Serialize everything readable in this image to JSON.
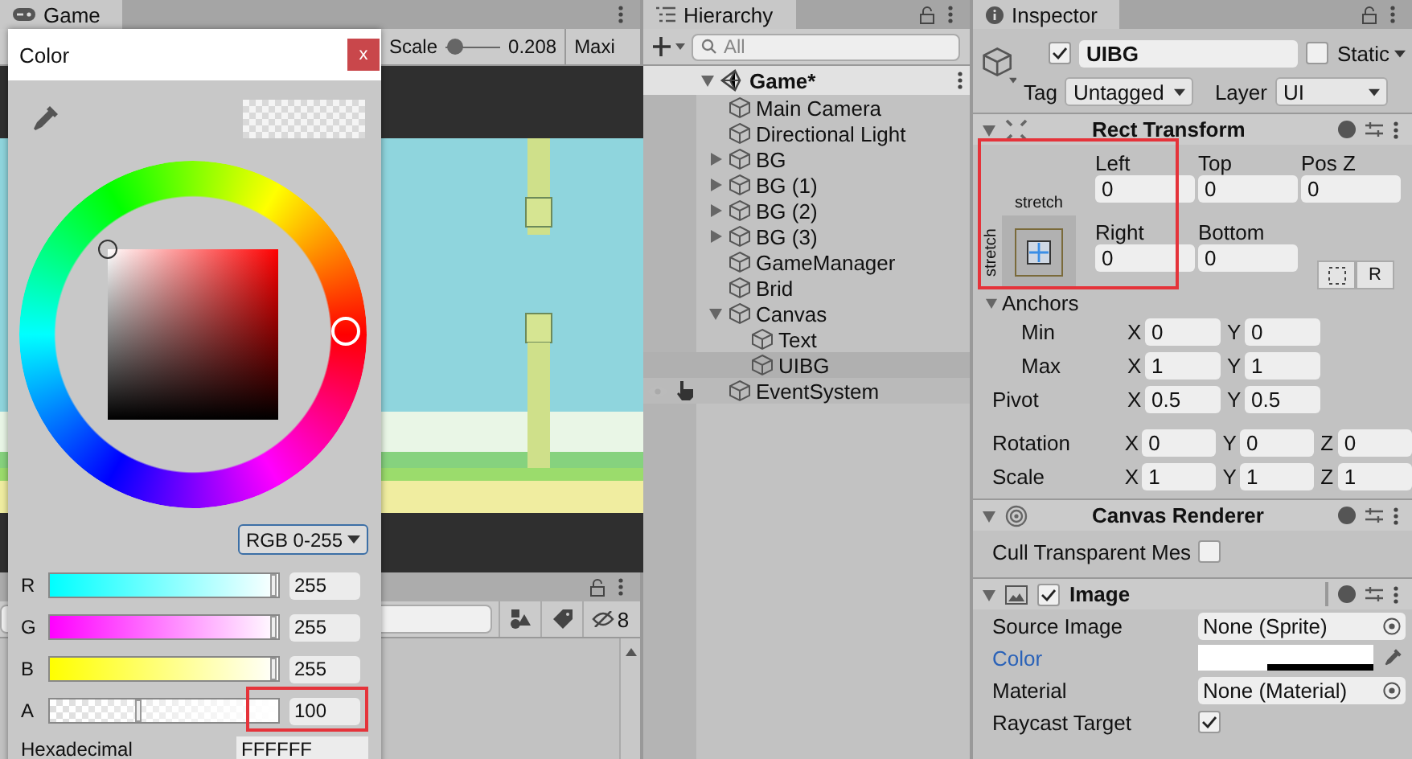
{
  "game": {
    "tab": "Game",
    "scale": {
      "label": "Scale",
      "level": 0.02,
      "value": "0.208"
    },
    "aspect": "Maxi"
  },
  "project": {
    "hidden_count": "8"
  },
  "color_window": {
    "title": "Color",
    "close": "x",
    "mode": "RGB 0-255",
    "channels": [
      {
        "label": "R",
        "kind": "red",
        "level": 1,
        "value": "255"
      },
      {
        "label": "G",
        "kind": "green",
        "level": 1,
        "value": "255"
      },
      {
        "label": "B",
        "kind": "blue",
        "level": 1,
        "value": "255"
      },
      {
        "label": "A",
        "kind": "alpha",
        "level": 0.39,
        "value": "100"
      }
    ],
    "hex_label": "Hexadecimal",
    "hex": "FFFFFF"
  },
  "hierarchy": {
    "tab": "Hierarchy",
    "search_placeholder": "All",
    "scene": {
      "name": "Game*",
      "expanded": true,
      "children": [
        {
          "name": "Main Camera",
          "selected": false,
          "hovered": false
        },
        {
          "name": "Directional Light",
          "selected": false,
          "hovered": false
        },
        {
          "name": "BG",
          "expanded": false,
          "selected": false,
          "hovered": false
        },
        {
          "name": "BG (1)",
          "expanded": false,
          "selected": false,
          "hovered": false
        },
        {
          "name": "BG (2)",
          "expanded": false,
          "selected": false,
          "hovered": false
        },
        {
          "name": "BG (3)",
          "expanded": false,
          "selected": false,
          "hovered": false
        },
        {
          "name": "GameManager",
          "selected": false,
          "hovered": false
        },
        {
          "name": "Brid",
          "selected": false,
          "hovered": false
        },
        {
          "name": "Canvas",
          "expanded": true,
          "selected": false,
          "hovered": false,
          "children": [
            {
              "name": "Text",
              "selected": false,
              "hovered": false
            },
            {
              "name": "UIBG",
              "selected": true,
              "hovered": false
            }
          ]
        },
        {
          "name": "EventSystem",
          "selected": false,
          "hovered": true
        }
      ]
    }
  },
  "inspector": {
    "tab": "Inspector",
    "object": {
      "active": true,
      "name": "UIBG",
      "static": false,
      "static_label": "Static",
      "tag_label": "Tag",
      "tag": "Untagged",
      "layer_label": "Layer",
      "layer": "UI"
    },
    "rect_transform": {
      "title": "Rect Transform",
      "expanded": true,
      "preset_h": "stretch",
      "preset_v": "stretch",
      "fields": [
        {
          "label": "Left",
          "value": "0"
        },
        {
          "label": "Top",
          "value": "0"
        },
        {
          "label": "Pos Z",
          "value": "0"
        },
        {
          "label": "Right",
          "value": "0"
        },
        {
          "label": "Bottom",
          "value": "0"
        }
      ],
      "raw_button": "R",
      "anchors": {
        "label": "Anchors",
        "expanded": true,
        "rows": [
          {
            "label": "Min",
            "axes": [
              {
                "axis": "X",
                "value": "0"
              },
              {
                "axis": "Y",
                "value": "0"
              }
            ]
          },
          {
            "label": "Max",
            "axes": [
              {
                "axis": "X",
                "value": "1"
              },
              {
                "axis": "Y",
                "value": "1"
              }
            ]
          }
        ]
      },
      "rows": [
        {
          "label": "Pivot",
          "axes": [
            {
              "axis": "X",
              "value": "0.5"
            },
            {
              "axis": "Y",
              "value": "0.5"
            }
          ]
        },
        {
          "label": "Rotation",
          "axes": [
            {
              "axis": "X",
              "value": "0"
            },
            {
              "axis": "Y",
              "value": "0"
            },
            {
              "axis": "Z",
              "value": "0"
            }
          ]
        },
        {
          "label": "Scale",
          "axes": [
            {
              "axis": "X",
              "value": "1"
            },
            {
              "axis": "Y",
              "value": "1"
            },
            {
              "axis": "Z",
              "value": "1"
            }
          ]
        }
      ]
    },
    "components": [
      {
        "kind": "renderer",
        "title": "Canvas Renderer",
        "expanded": true,
        "props": [
          {
            "kind": "checkbox",
            "label": "Cull Transparent Mes",
            "checked": false,
            "highlighted": false
          }
        ]
      },
      {
        "kind": "image",
        "title": "Image",
        "enabled": true,
        "expanded": true,
        "props": [
          {
            "kind": "object",
            "label": "Source Image",
            "value": "None (Sprite)",
            "highlighted": false
          },
          {
            "kind": "color",
            "label": "Color",
            "level": 0.39,
            "highlighted": true
          },
          {
            "kind": "object",
            "label": "Material",
            "value": "None (Material)",
            "highlighted": false
          },
          {
            "kind": "checkbox",
            "label": "Raycast Target",
            "checked": true,
            "highlighted": false
          }
        ]
      }
    ]
  }
}
